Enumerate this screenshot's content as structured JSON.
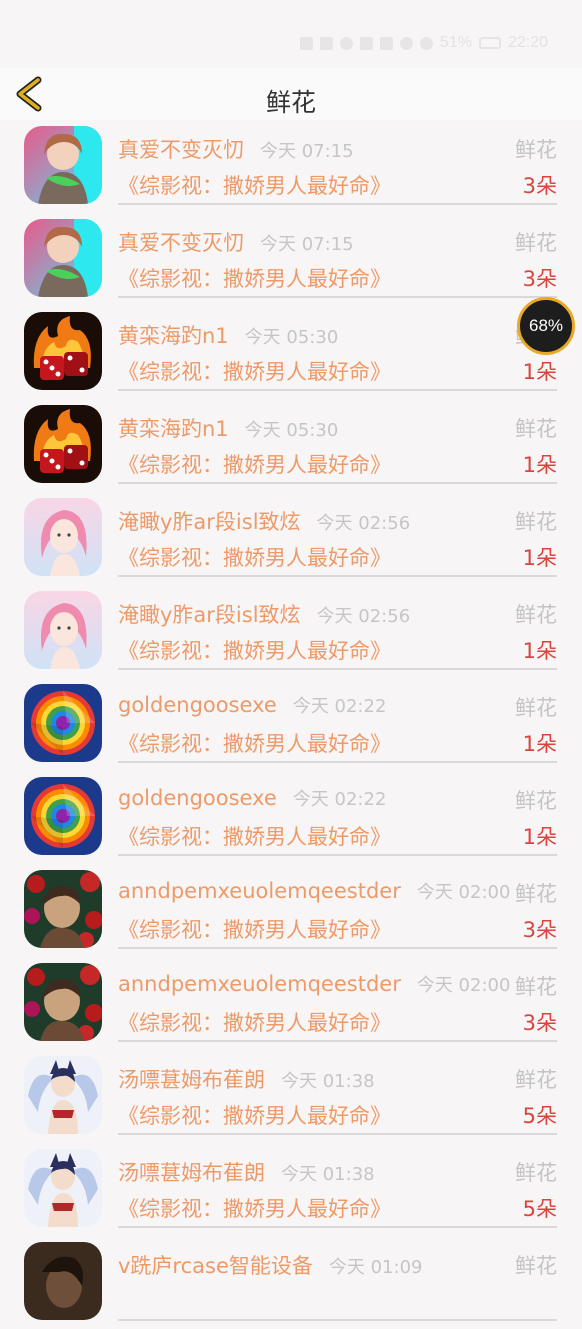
{
  "status": {
    "battery_text": "51%",
    "time_text": "22:20"
  },
  "header": {
    "title": "鲜花",
    "back_icon": "chevron-left-icon"
  },
  "overlay": {
    "percent": "68%"
  },
  "colors": {
    "accent": "#ee9a68",
    "count": "#d8453e",
    "back": "#e0b11a"
  },
  "items": [
    {
      "user": "真爱不变灭忉",
      "time": "今天 07:15",
      "gift": "鲜花",
      "book": "《综影视：撒娇男人最好命》",
      "count": "3朵",
      "avatar": "anime-boy"
    },
    {
      "user": "真爱不变灭忉",
      "time": "今天 07:15",
      "gift": "鲜花",
      "book": "《综影视：撒娇男人最好命》",
      "count": "3朵",
      "avatar": "anime-boy"
    },
    {
      "user": "黄栾海趵n1",
      "time": "今天 05:30",
      "gift": "鲜花",
      "book": "《综影视：撒娇男人最好命》",
      "count": "1朵",
      "avatar": "fire-dice"
    },
    {
      "user": "黄栾海趵n1",
      "time": "今天 05:30",
      "gift": "鲜花",
      "book": "《综影视：撒娇男人最好命》",
      "count": "1朵",
      "avatar": "fire-dice"
    },
    {
      "user": "淹瞰y胙ar段isl致炫",
      "time": "今天 02:56",
      "gift": "鲜花",
      "book": "《综影视：撒娇男人最好命》",
      "count": "1朵",
      "avatar": "pink-girl"
    },
    {
      "user": "淹瞰y胙ar段isl致炫",
      "time": "今天 02:56",
      "gift": "鲜花",
      "book": "《综影视：撒娇男人最好命》",
      "count": "1朵",
      "avatar": "pink-girl"
    },
    {
      "user": "goldengoosexe",
      "time": "今天 02:22",
      "gift": "鲜花",
      "book": "《综影视：撒娇男人最好命》",
      "count": "1朵",
      "avatar": "rainbow-spiral"
    },
    {
      "user": "goldengoosexe",
      "time": "今天 02:22",
      "gift": "鲜花",
      "book": "《综影视：撒娇男人最好命》",
      "count": "1朵",
      "avatar": "rainbow-spiral"
    },
    {
      "user": "anndpemxeuolemqeestder",
      "time": "今天 02:00",
      "gift": "鲜花",
      "book": "《综影视：撒娇男人最好命》",
      "count": "3朵",
      "avatar": "roses-portrait"
    },
    {
      "user": "anndpemxeuolemqeestder",
      "time": "今天 02:00",
      "gift": "鲜花",
      "book": "《综影视：撒娇男人最好命》",
      "count": "3朵",
      "avatar": "roses-portrait"
    },
    {
      "user": "汤嘌葚姆布萑朗",
      "time": "今天 01:38",
      "gift": "鲜花",
      "book": "《综影视：撒娇男人最好命》",
      "count": "5朵",
      "avatar": "fox-girl"
    },
    {
      "user": "汤嘌葚姆布萑朗",
      "time": "今天 01:38",
      "gift": "鲜花",
      "book": "《综影视：撒娇男人最好命》",
      "count": "5朵",
      "avatar": "fox-girl"
    },
    {
      "user": "v跣庐rcase智能设备",
      "time": "今天 01:09",
      "gift": "鲜花",
      "book": "",
      "count": "",
      "avatar": "dark-photo"
    }
  ]
}
